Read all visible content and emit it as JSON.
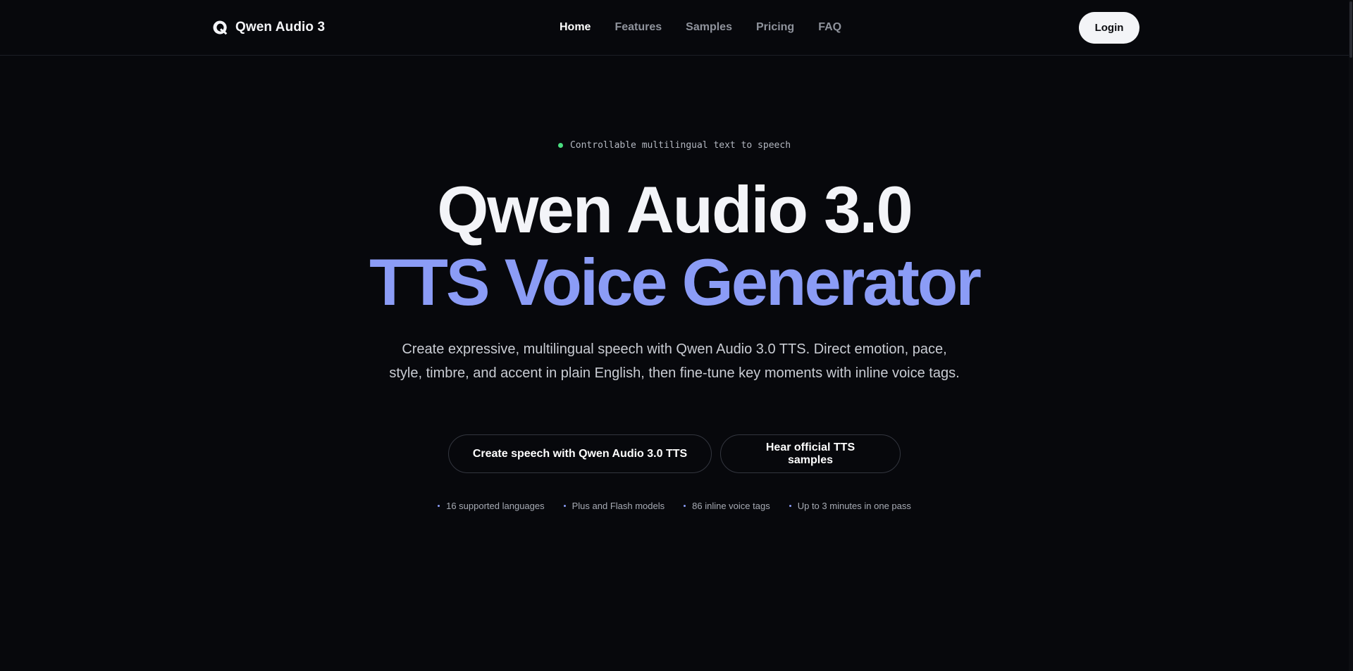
{
  "brand": {
    "name": "Qwen Audio 3",
    "logo_icon": "q-logo-icon"
  },
  "nav": {
    "items": [
      {
        "label": "Home",
        "active": true
      },
      {
        "label": "Features",
        "active": false
      },
      {
        "label": "Samples",
        "active": false
      },
      {
        "label": "Pricing",
        "active": false
      },
      {
        "label": "FAQ",
        "active": false
      }
    ]
  },
  "header": {
    "login_label": "Login"
  },
  "hero": {
    "eyebrow": "Controllable multilingual text to speech",
    "title_line1": "Qwen Audio 3.0",
    "title_line2": "TTS Voice Generator",
    "subtitle": "Create expressive, multilingual speech with Qwen Audio 3.0 TTS. Direct emotion, pace, style, timbre, and accent in plain English, then fine-tune key moments with inline voice tags.",
    "cta_primary": "Create speech with Qwen Audio 3.0 TTS",
    "cta_secondary": "Hear official TTS samples",
    "features": [
      "16 supported languages",
      "Plus and Flash models",
      "86 inline voice tags",
      "Up to 3 minutes in one pass"
    ]
  },
  "colors": {
    "background": "#07080c",
    "accent": "#8b9cf6",
    "status_dot": "#4ade80",
    "login_bg": "#f3f4f7"
  }
}
